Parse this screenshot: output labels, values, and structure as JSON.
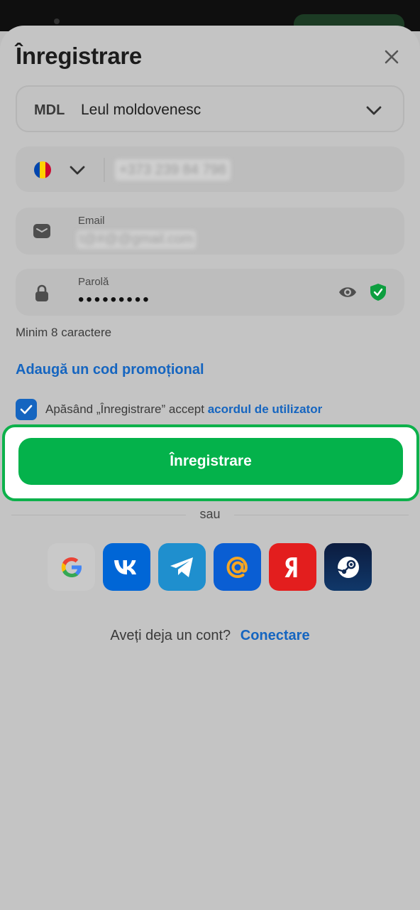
{
  "header": {
    "title": "Înregistrare",
    "close_icon": "close-icon"
  },
  "currency": {
    "code": "MDL",
    "name": "Leul moldovenesc",
    "icon": "chevron-down-icon"
  },
  "phone": {
    "flag_colors": [
      "#0046ae",
      "#ffd200",
      "#cc092f"
    ],
    "value": "+373 239 84 798"
  },
  "email": {
    "label": "Email",
    "value": "t@#@@gmail.com",
    "icon": "envelope-icon"
  },
  "password": {
    "label": "Parolă",
    "value": "•••••••••",
    "icon": "lock-icon",
    "hint": "Minim 8 caractere"
  },
  "promo": {
    "label": "Adaugă un cod promoțional"
  },
  "agreement": {
    "checked": true,
    "text": "Apăsând „Înregistrare” accept",
    "link": "acordul de utilizator"
  },
  "register_button": {
    "label": "Înregistrare"
  },
  "divider": {
    "label": "sau"
  },
  "social": [
    {
      "name": "google",
      "icon": "google-icon"
    },
    {
      "name": "vk",
      "icon": "vk-icon"
    },
    {
      "name": "telegram",
      "icon": "telegram-icon"
    },
    {
      "name": "mail",
      "icon": "mail-ru-icon"
    },
    {
      "name": "yandex",
      "icon": "yandex-icon"
    },
    {
      "name": "steam",
      "icon": "steam-icon"
    }
  ],
  "login": {
    "prompt": "Aveți deja un cont?",
    "link": "Conectare"
  },
  "colors": {
    "accent_green": "#04b24b",
    "link_blue": "#1565c0",
    "frame_green": "#0db14b"
  }
}
